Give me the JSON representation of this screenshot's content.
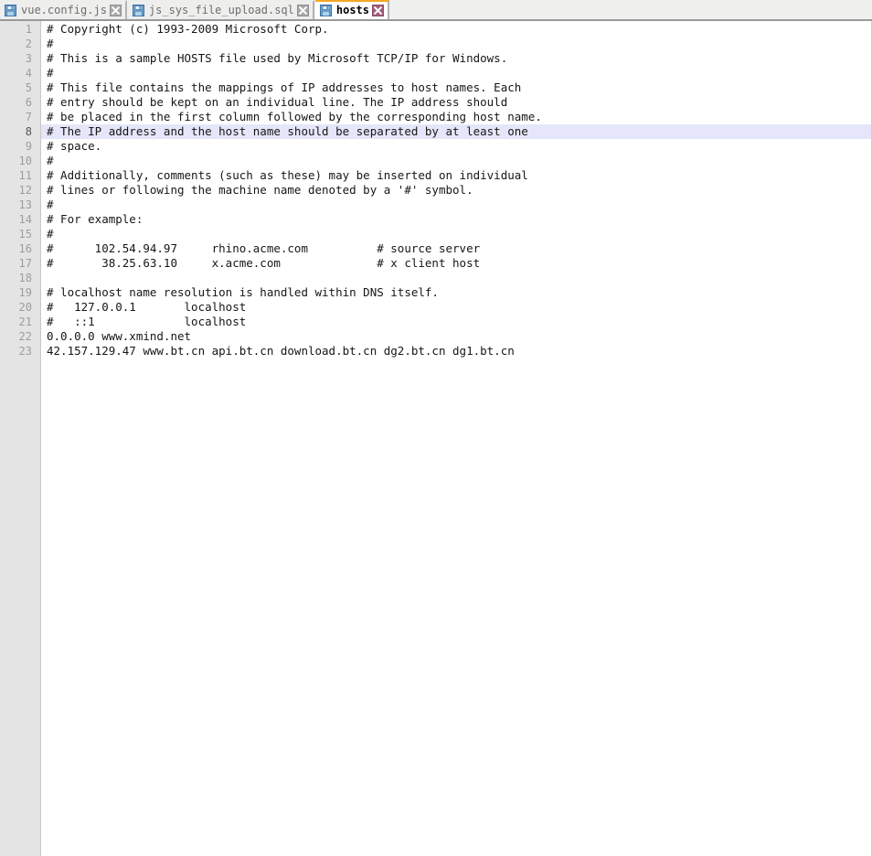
{
  "window": {
    "title": "hosts",
    "accent_active_tab": "#f5a623",
    "gutter_bg": "#e4e4e4",
    "current_line_highlight": "#e6e6fa"
  },
  "tab_bar": {
    "tabs": [
      {
        "label": "vue.config.js",
        "icon": "save-floppy-icon",
        "close_icon": "close-icon",
        "active": false
      },
      {
        "label": "js_sys_file_upload.sql",
        "icon": "save-floppy-icon",
        "close_icon": "close-icon",
        "active": false
      },
      {
        "label": "hosts",
        "icon": "save-floppy-icon",
        "close_icon": "close-icon",
        "active": true
      }
    ]
  },
  "editor": {
    "current_line": 8,
    "total_lines": 23,
    "line_numbers": [
      "1",
      "2",
      "3",
      "4",
      "5",
      "6",
      "7",
      "8",
      "9",
      "10",
      "11",
      "12",
      "13",
      "14",
      "15",
      "16",
      "17",
      "18",
      "19",
      "20",
      "21",
      "22",
      "23"
    ],
    "lines": [
      "# Copyright (c) 1993-2009 Microsoft Corp.",
      "#",
      "# This is a sample HOSTS file used by Microsoft TCP/IP for Windows.",
      "#",
      "# This file contains the mappings of IP addresses to host names. Each",
      "# entry should be kept on an individual line. The IP address should",
      "# be placed in the first column followed by the corresponding host name.",
      "# The IP address and the host name should be separated by at least one",
      "# space.",
      "#",
      "# Additionally, comments (such as these) may be inserted on individual",
      "# lines or following the machine name denoted by a '#' symbol.",
      "#",
      "# For example:",
      "#",
      "#      102.54.94.97     rhino.acme.com          # source server",
      "#       38.25.63.10     x.acme.com              # x client host",
      "",
      "# localhost name resolution is handled within DNS itself.",
      "#   127.0.0.1       localhost",
      "#   ::1             localhost",
      "0.0.0.0 www.xmind.net",
      "42.157.129.47 www.bt.cn api.bt.cn download.bt.cn dg2.bt.cn dg1.bt.cn"
    ]
  }
}
